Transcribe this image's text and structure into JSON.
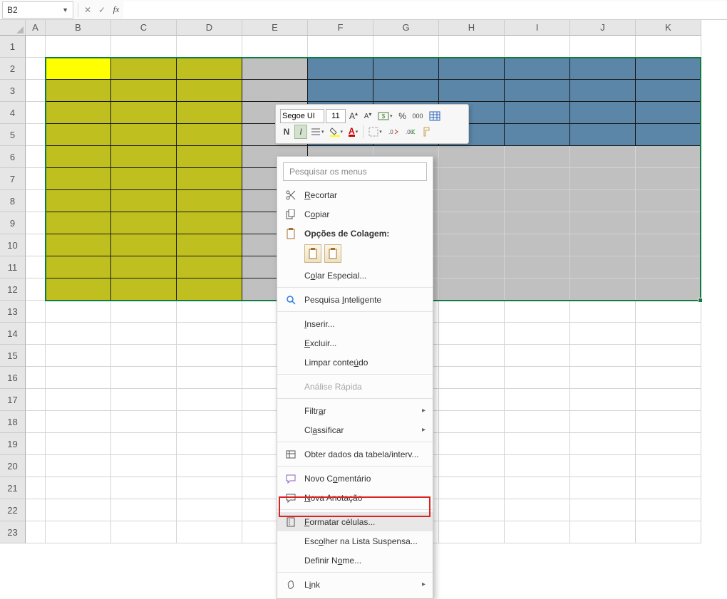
{
  "formula_bar": {
    "name_box": "B2",
    "formula": ""
  },
  "columns": [
    "A",
    "B",
    "C",
    "D",
    "E",
    "F",
    "G",
    "H",
    "I",
    "J",
    "K"
  ],
  "rows": [
    "1",
    "2",
    "3",
    "4",
    "5",
    "6",
    "7",
    "8",
    "9",
    "10",
    "11",
    "12",
    "13",
    "14",
    "15",
    "16",
    "17",
    "18",
    "19",
    "20",
    "21",
    "22",
    "23"
  ],
  "selection": {
    "ref": "B2:K12"
  },
  "olive_region": "B2:D12",
  "yellow_cell": "B2",
  "gray_region": "E2:E12",
  "steel_region": "F2:K5",
  "gray_region2": "F6:K12",
  "mini_toolbar": {
    "font": "Segoe UI",
    "size": "11",
    "buttons_row1": [
      "increase-font",
      "decrease-font",
      "accounting-format",
      "percent-format",
      "comma-format",
      "table-format"
    ],
    "buttons_row2": {
      "bold": "N",
      "italic": "I",
      "align": "align",
      "fill_color": "fill",
      "font_color": "A",
      "borders": "borders",
      "decrease_decimal": "dec",
      "increase_decimal": "inc",
      "format_painter": "brush"
    }
  },
  "context_menu": {
    "search_placeholder": "Pesquisar os menus",
    "items": [
      {
        "id": "cut",
        "icon": "scissors",
        "label_pre": "",
        "u": "R",
        "label_post": "ecortar"
      },
      {
        "id": "copy",
        "icon": "copy",
        "label_pre": "C",
        "u": "o",
        "label_post": "piar"
      },
      {
        "id": "paste-options-header",
        "icon": "clipboard",
        "label": "Opções de Colagem:",
        "bold": true
      },
      {
        "id": "paste-options",
        "type": "paste-opts"
      },
      {
        "id": "paste-special",
        "label_pre": "C",
        "u": "o",
        "label_post": "lar Especial..."
      },
      {
        "type": "sep"
      },
      {
        "id": "smart-lookup",
        "icon": "search",
        "label_pre": "Pesquisa ",
        "u": "I",
        "label_post": "nteligente"
      },
      {
        "type": "sep"
      },
      {
        "id": "insert",
        "label_pre": "",
        "u": "I",
        "label_post": "nserir..."
      },
      {
        "id": "delete",
        "label_pre": "",
        "u": "E",
        "label_post": "xcluir..."
      },
      {
        "id": "clear",
        "label_pre": "Limpar conte",
        "u": "ú",
        "label_post": "do"
      },
      {
        "type": "sep"
      },
      {
        "id": "quick-analysis",
        "icon": "grid",
        "label": "Análise Rápida",
        "disabled": true
      },
      {
        "type": "sep"
      },
      {
        "id": "filter",
        "label_pre": "Filtr",
        "u": "a",
        "label_post": "r",
        "submenu": true
      },
      {
        "id": "sort",
        "label_pre": "Cl",
        "u": "a",
        "label_post": "ssificar",
        "submenu": true
      },
      {
        "type": "sep"
      },
      {
        "id": "get-table-data",
        "icon": "table",
        "label": "Obter dados da tabela/interv..."
      },
      {
        "type": "sep"
      },
      {
        "id": "new-comment",
        "icon": "comment",
        "label_pre": "Novo C",
        "u": "o",
        "label_post": "mentário"
      },
      {
        "id": "new-note",
        "icon": "note",
        "label_pre": "",
        "u": "N",
        "label_post": "ova Anotação"
      },
      {
        "type": "sep"
      },
      {
        "id": "format-cells",
        "icon": "format",
        "label_pre": "",
        "u": "F",
        "label_post": "ormatar células...",
        "highlighted": true
      },
      {
        "id": "pick-list",
        "label_pre": "Esc",
        "u": "o",
        "label_post": "lher na Lista Suspensa..."
      },
      {
        "id": "define-name",
        "label_pre": "Definir N",
        "u": "o",
        "label_post": "me..."
      },
      {
        "type": "sep"
      },
      {
        "id": "link",
        "icon": "link",
        "label_pre": "L",
        "u": "i",
        "label_post": "nk",
        "submenu": true
      }
    ]
  }
}
